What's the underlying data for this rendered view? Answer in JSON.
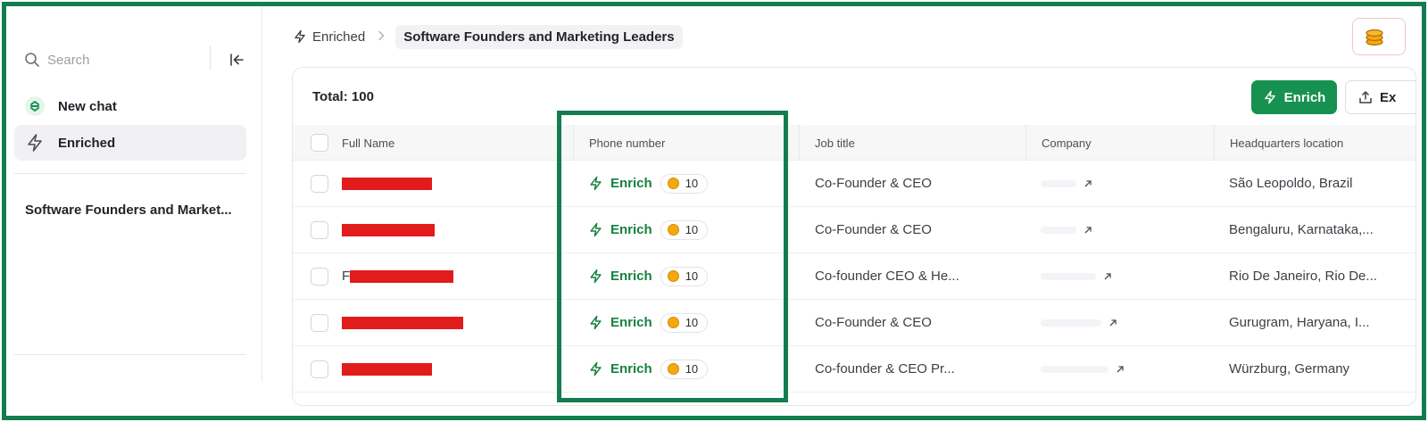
{
  "sidebar": {
    "search_placeholder": "Search",
    "nav": [
      {
        "label": "New chat",
        "icon": "logo-icon"
      },
      {
        "label": "Enriched",
        "icon": "bolt-icon"
      }
    ],
    "lists": [
      "Software Founders and Market..."
    ]
  },
  "breadcrumb": {
    "parent": "Enriched",
    "current": "Software Founders and Marketing Leaders"
  },
  "toolbar": {
    "total_label": "Total: 100",
    "enrich_label": "Enrich",
    "export_label": "Ex"
  },
  "table": {
    "columns": [
      "Full Name",
      "Phone number",
      "Job title",
      "Company",
      "Headquarters location"
    ],
    "rows": [
      {
        "name_partial": "",
        "phone_action": "Enrich",
        "cost": "10",
        "job_title": "Co-Founder & CEO",
        "hq": "São Leopoldo, Brazil"
      },
      {
        "name_partial": "",
        "phone_action": "Enrich",
        "cost": "10",
        "job_title": "Co-Founder & CEO",
        "hq": "Bengaluru, Karnataka,..."
      },
      {
        "name_partial": "F",
        "phone_action": "Enrich",
        "cost": "10",
        "job_title": "Co-founder CEO & He...",
        "hq": "Rio De Janeiro, Rio De..."
      },
      {
        "name_partial": "",
        "phone_action": "Enrich",
        "cost": "10",
        "job_title": "Co-Founder & CEO",
        "hq": "Gurugram, Haryana, I..."
      },
      {
        "name_partial": "",
        "phone_action": "Enrich",
        "cost": "10",
        "job_title": "Co-founder & CEO Pr...",
        "hq": "Würzburg, Germany"
      }
    ]
  },
  "colors": {
    "accent": "#16914f",
    "annotation_frame": "#137d4f",
    "redaction": "#e21b1b",
    "coin": "#f5a70e"
  }
}
